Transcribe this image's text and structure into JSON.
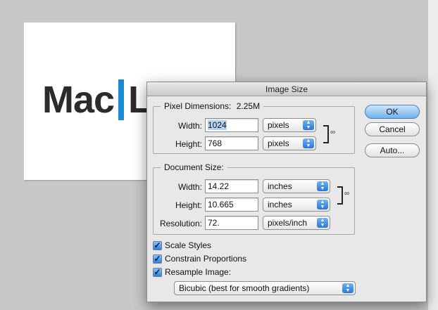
{
  "background_document": {
    "logo_text_left": "Mac",
    "logo_text_right": "Li"
  },
  "dialog": {
    "title": "Image Size",
    "pixel_dimensions": {
      "title": "Pixel Dimensions:",
      "size": "2.25M",
      "width_label": "Width:",
      "width_value": "1024",
      "width_unit": "pixels",
      "height_label": "Height:",
      "height_value": "768",
      "height_unit": "pixels"
    },
    "document_size": {
      "title": "Document Size:",
      "width_label": "Width:",
      "width_value": "14.22",
      "width_unit": "inches",
      "height_label": "Height:",
      "height_value": "10.665",
      "height_unit": "inches",
      "resolution_label": "Resolution:",
      "resolution_value": "72.",
      "resolution_unit": "pixels/inch"
    },
    "buttons": {
      "ok": "OK",
      "cancel": "Cancel",
      "auto": "Auto..."
    },
    "checkboxes": {
      "scale_styles": "Scale Styles",
      "constrain_proportions": "Constrain Proportions",
      "resample_image": "Resample Image:"
    },
    "resample_method": "Bicubic (best for smooth gradients)"
  },
  "colors": {
    "logo_bar": "#1a8ad4",
    "accent": "#2a78d6",
    "background": "#c8c8c8"
  },
  "icons": {
    "link_chain": "chain-link-icon",
    "popup_arrows": "updown-arrows-icon",
    "checkmark": "checkmark-icon"
  }
}
